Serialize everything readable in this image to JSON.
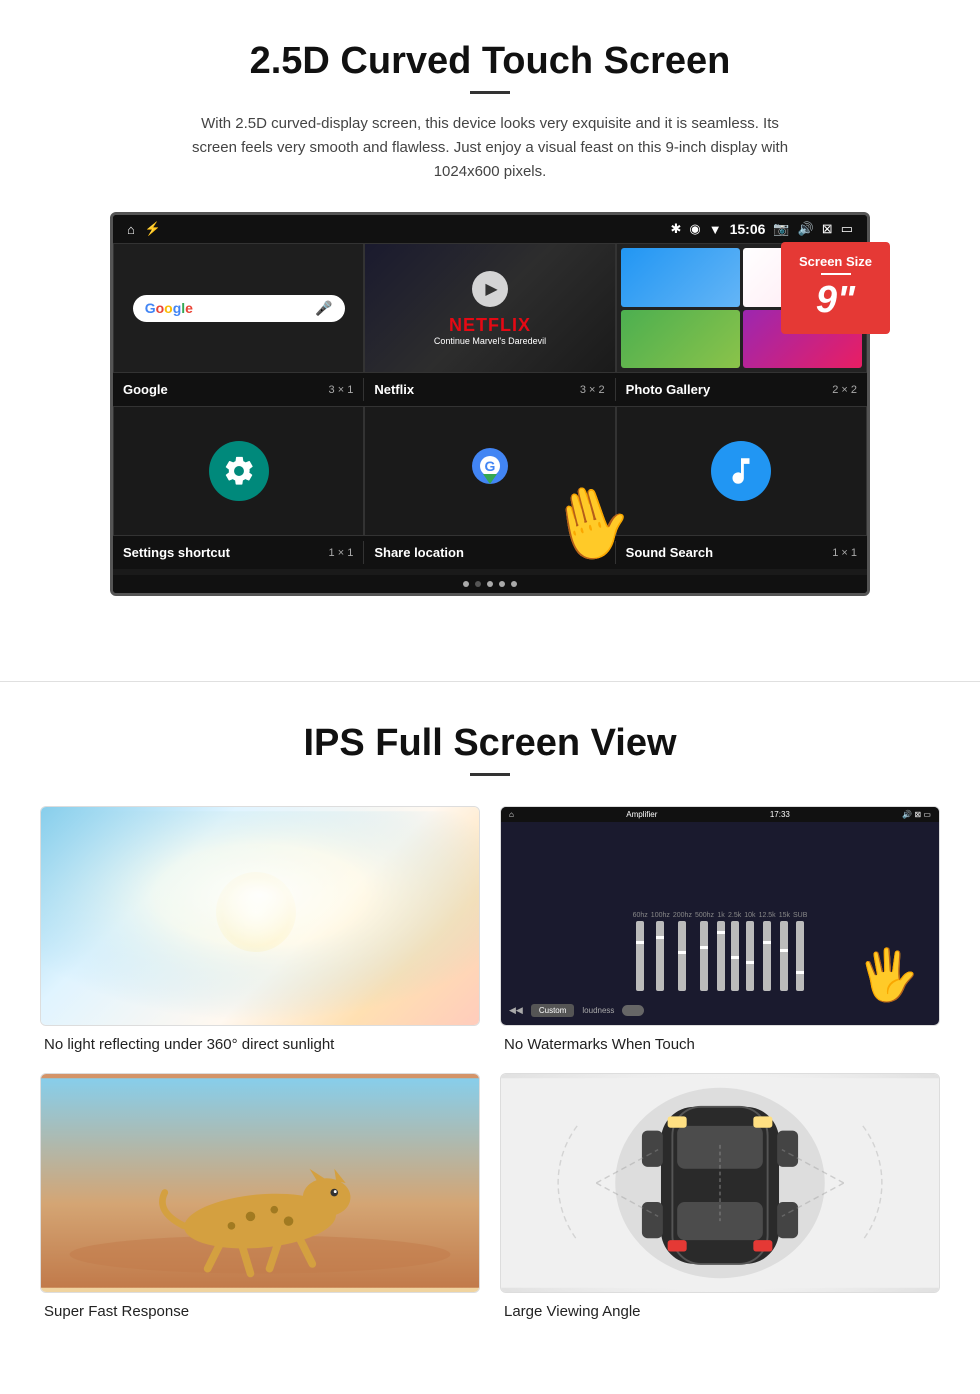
{
  "section1": {
    "title": "2.5D Curved Touch Screen",
    "description": "With 2.5D curved-display screen, this device looks very exquisite and it is seamless. Its screen feels very smooth and flawless. Just enjoy a visual feast on this 9-inch display with 1024x600 pixels.",
    "screen_size_label": "Screen Size",
    "screen_size_number": "9\"",
    "status_time": "15:06",
    "apps": [
      {
        "name": "Google",
        "size": "3 × 1"
      },
      {
        "name": "Netflix",
        "size": "3 × 2"
      },
      {
        "name": "Photo Gallery",
        "size": "2 × 2"
      },
      {
        "name": "Settings shortcut",
        "size": "1 × 1"
      },
      {
        "name": "Share location",
        "size": "1 × 1"
      },
      {
        "name": "Sound Search",
        "size": "1 × 1"
      }
    ],
    "netflix_text": "NETFLIX",
    "netflix_sub": "Continue Marvel's Daredevil"
  },
  "section2": {
    "title": "IPS Full Screen View",
    "features": [
      {
        "label": "No light reflecting under 360° direct sunlight",
        "type": "sunlight"
      },
      {
        "label": "No Watermarks When Touch",
        "type": "amplifier"
      },
      {
        "label": "Super Fast Response",
        "type": "cheetah"
      },
      {
        "label": "Large Viewing Angle",
        "type": "car"
      }
    ],
    "amp_title": "Amplifier",
    "amp_time": "17:33",
    "amp_custom": "Custom",
    "amp_loudness": "loudness"
  }
}
